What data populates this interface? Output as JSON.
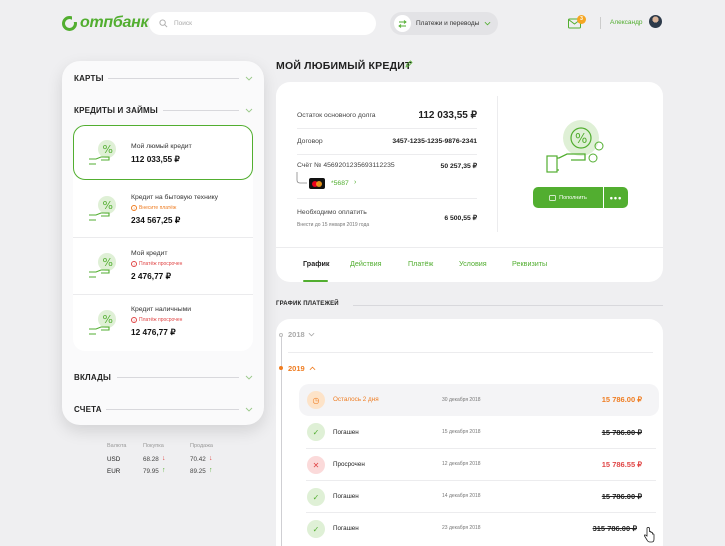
{
  "header": {
    "logo_text": "отпбанк",
    "search_placeholder": "Поиск",
    "payments_label": "Платежи и переводы",
    "mail_badge": "3",
    "user_name": "Александр"
  },
  "sidebar": {
    "sections": {
      "cards": "КАРТЫ",
      "credits": "КРЕДИТЫ И ЗАЙМЫ",
      "deposits": "ВКЛАДЫ",
      "accounts": "СЧЕТА"
    },
    "credits": [
      {
        "name": "Мой люмый кредит",
        "warning": "",
        "amount": "112 033,55 ₽"
      },
      {
        "name": "Кредит на бытовую технику",
        "warning": "Внесите платёж",
        "amount": "234 567,25 ₽"
      },
      {
        "name": "Мой кредит",
        "warning": "Платёж просрочен",
        "amount": "2 476,77 ₽"
      },
      {
        "name": "Кредит наличными",
        "warning": "Платёж просрочен",
        "amount": "12 476,77 ₽"
      }
    ]
  },
  "fx": {
    "headers": {
      "currency": "Валюта",
      "buy": "Покупка",
      "sell": "Продажа"
    },
    "rows": [
      {
        "currency": "USD",
        "buy": "68.28",
        "buy_trend": "down",
        "sell": "70.42",
        "sell_trend": "down"
      },
      {
        "currency": "EUR",
        "buy": "79.95",
        "buy_trend": "up",
        "sell": "89.25",
        "sell_trend": "up"
      }
    ]
  },
  "main": {
    "title": "МОЙ ЛЮБИМЫЙ КРЕДИТ",
    "debt_label": "Остаток основного долга",
    "debt_value": "112 033,55 ₽",
    "contract_label": "Договор",
    "contract_value": "3457-1235-1235-9876-2341",
    "account_label": "Счёт № 4569201235693112235",
    "account_value": "50 257,35 ₽",
    "card_number": "*5687",
    "due_label": "Необходимо оплатить",
    "due_sub": "Внести до 15 января 2019 года",
    "due_value": "6 500,55 ₽",
    "pay_button": "Пополнить",
    "more_button": "•••",
    "tabs": [
      "График",
      "Действия",
      "Платёж",
      "Условия",
      "Реквизиты"
    ]
  },
  "schedule": {
    "title": "ГРАФИК ПЛАТЕЖЕЙ",
    "years": [
      "2018",
      "2019"
    ],
    "payments": [
      {
        "status": "Осталось 2 дня",
        "date": "30 декабря 2018",
        "amount": "15 786.00 ₽",
        "kind": "pending"
      },
      {
        "status": "Погашен",
        "date": "15 декабря 2018",
        "amount": "15 786.00 ₽",
        "kind": "paid"
      },
      {
        "status": "Просрочен",
        "date": "12 декабря 2018",
        "amount": "15 786.55 ₽",
        "kind": "overdue"
      },
      {
        "status": "Погашен",
        "date": "14 декабря 2018",
        "amount": "15 786.00 ₽",
        "kind": "paid"
      },
      {
        "status": "Погашен",
        "date": "23 декабря 2018",
        "amount": "315 786.00 ₽",
        "kind": "paid"
      }
    ]
  },
  "colors": {
    "brand_green": "#52ae30",
    "accent_orange": "#ef7d22",
    "alert_red": "#e04646"
  }
}
